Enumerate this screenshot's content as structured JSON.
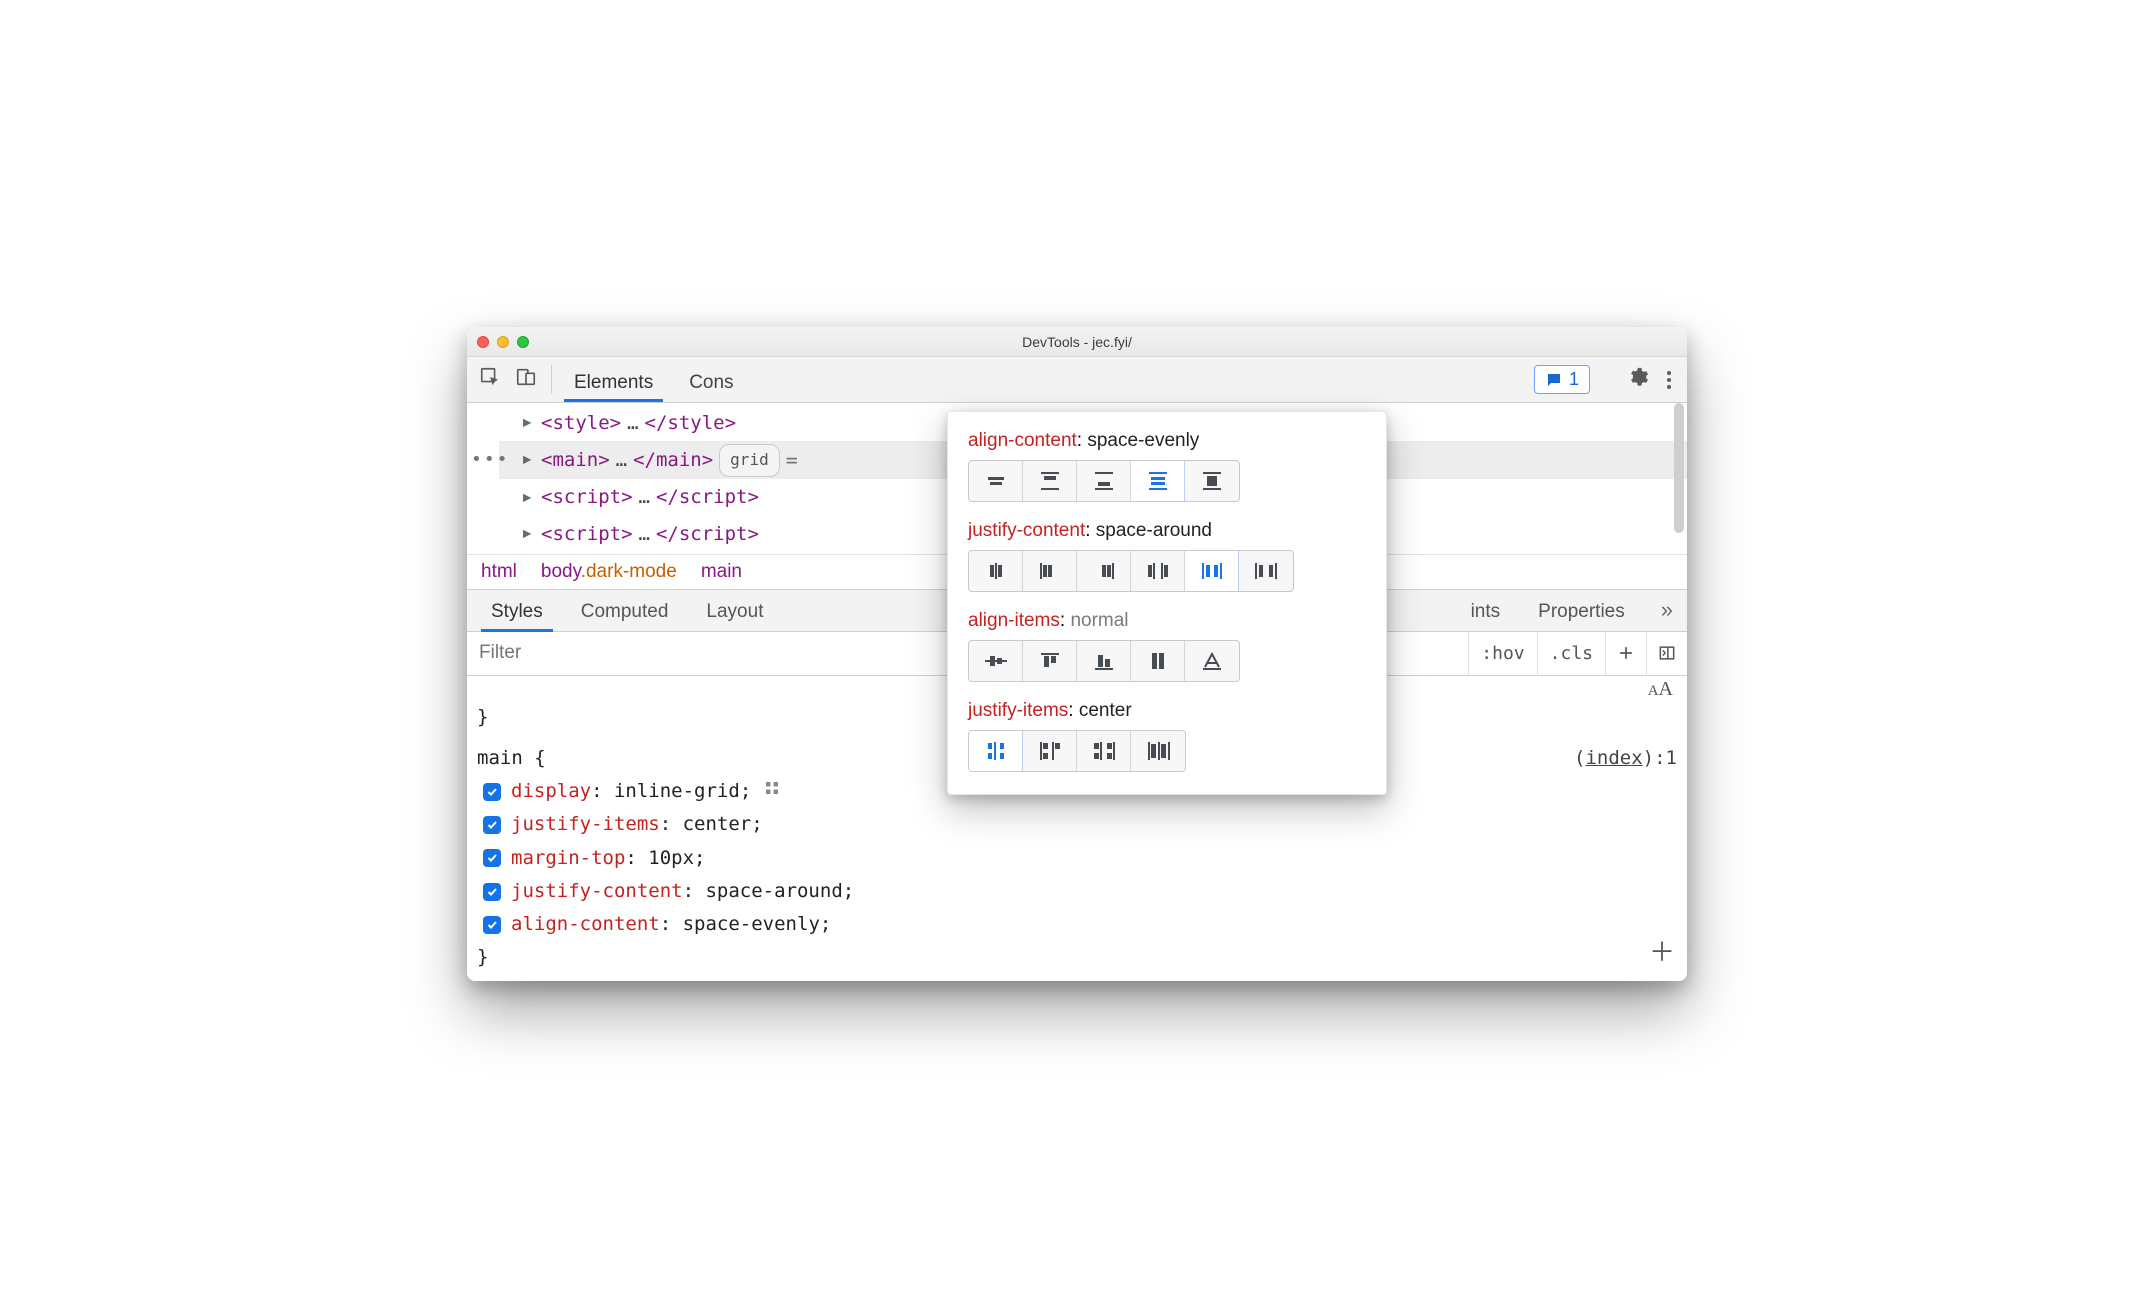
{
  "window": {
    "title": "DevTools - jec.fyi/"
  },
  "toolbar": {
    "tabs": [
      "Elements",
      "Cons"
    ],
    "active_tab": 0,
    "feedback_count": "1"
  },
  "dom": {
    "rows": [
      {
        "open": "<style>",
        "mid": "…",
        "close": "</style>"
      },
      {
        "open": "<main>",
        "mid": "…",
        "close": "</main>",
        "badge": "grid",
        "after": "=",
        "selected": true,
        "dots": "•••"
      },
      {
        "open": "<script>",
        "mid": "…",
        "close": "</script>"
      },
      {
        "open": "<script>",
        "mid": "…",
        "close": "</script>"
      }
    ]
  },
  "breadcrumbs": [
    {
      "tag": "html"
    },
    {
      "tag": "body",
      "cls": ".dark-mode"
    },
    {
      "tag": "main"
    }
  ],
  "panel_tabs": {
    "left": [
      "Styles",
      "Computed",
      "Layout"
    ],
    "right_partial": "ints",
    "right": [
      "Properties"
    ]
  },
  "filter": {
    "placeholder": "Filter",
    "hov": ":hov",
    "cls": ".cls"
  },
  "styles": {
    "closing_brace": "}",
    "selector": "main",
    "open_brace": "{",
    "source": "(index):1",
    "decls": [
      {
        "prop": "display",
        "val": "inline-grid",
        "grid_icon": true
      },
      {
        "prop": "justify-items",
        "val": "center"
      },
      {
        "prop": "margin-top",
        "val": "10px"
      },
      {
        "prop": "justify-content",
        "val": "space-around"
      },
      {
        "prop": "align-content",
        "val": "space-evenly"
      }
    ],
    "close_brace": "}"
  },
  "popover": {
    "sections": [
      {
        "prop": "align-content",
        "val": "space-evenly",
        "dim": false,
        "icons": 5,
        "active": 3
      },
      {
        "prop": "justify-content",
        "val": "space-around",
        "dim": false,
        "icons": 6,
        "active": 4
      },
      {
        "prop": "align-items",
        "val": "normal",
        "dim": true,
        "icons": 5,
        "active": -1
      },
      {
        "prop": "justify-items",
        "val": "center",
        "dim": false,
        "icons": 4,
        "active": 0
      }
    ]
  }
}
